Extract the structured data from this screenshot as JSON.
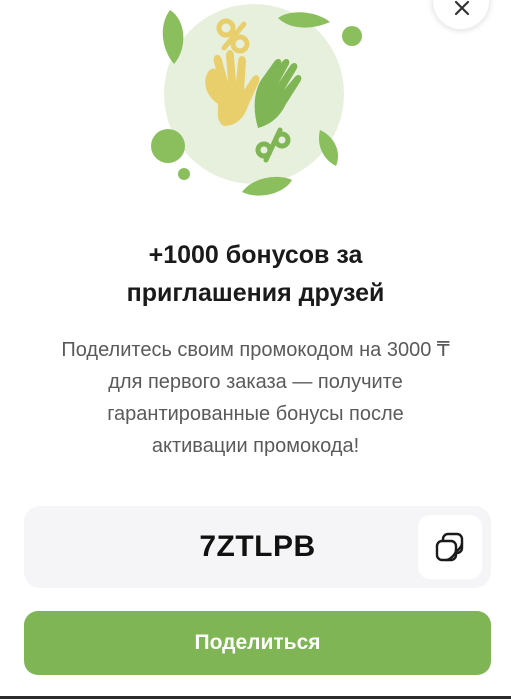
{
  "close": {
    "icon": "close-icon"
  },
  "hero": {
    "icon": "clapping-hands-illustration"
  },
  "title": {
    "line1": "+1000 бонусов за",
    "line2": "приглашения друзей"
  },
  "description": {
    "line1": "Поделитесь своим промокодом на 3000 ₸",
    "line2": "для первого заказа — получите",
    "line3": "гарантированные бонусы после",
    "line4": "активации промокода!"
  },
  "promo": {
    "code": "7ZTLPB",
    "copy_icon": "copy-icon"
  },
  "share": {
    "label": "Поделиться"
  },
  "colors": {
    "accent": "#7fb554",
    "hand_yellow": "#e9cf6b",
    "hand_green": "#7fb554",
    "circle_bg": "#e7f0dc"
  }
}
